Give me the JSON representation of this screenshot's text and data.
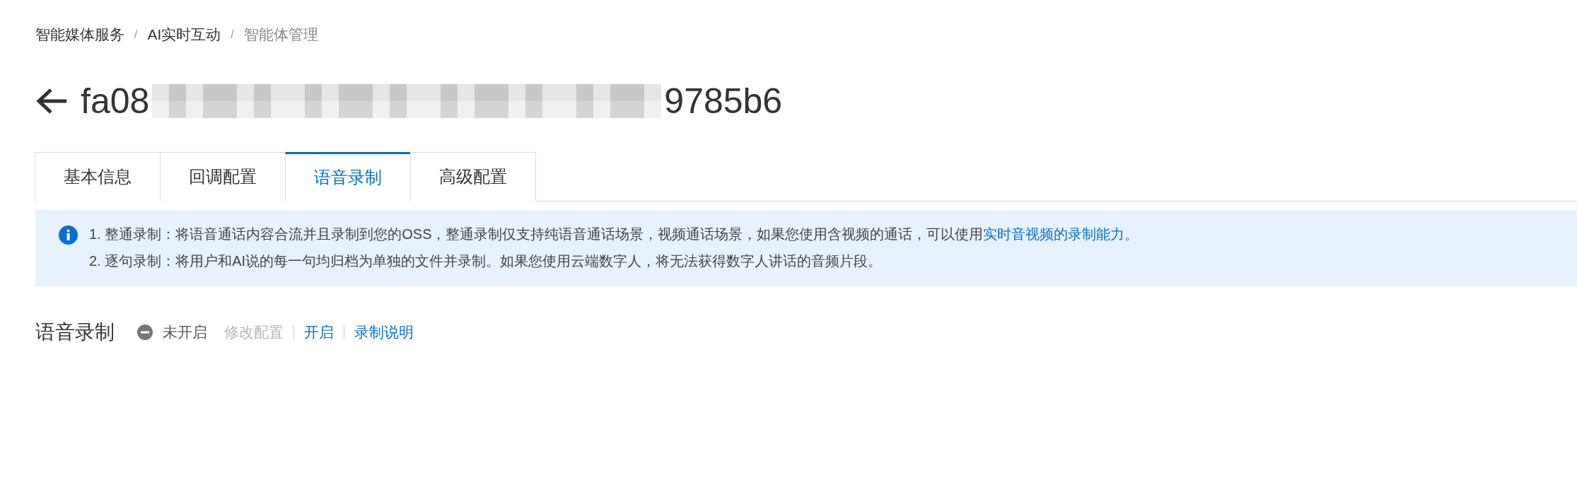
{
  "breadcrumb": [
    {
      "label": "智能媒体服务",
      "current": false
    },
    {
      "label": "AI实时互动",
      "current": false
    },
    {
      "label": "智能体管理",
      "current": true
    }
  ],
  "breadcrumb_separator": "/",
  "title": {
    "prefix": "fa08",
    "suffix": "9785b6"
  },
  "tabs": [
    {
      "label": "基本信息",
      "selected": false
    },
    {
      "label": "回调配置",
      "selected": false
    },
    {
      "label": "语音录制",
      "selected": true
    },
    {
      "label": "高级配置",
      "selected": false
    }
  ],
  "notice": {
    "lines": [
      {
        "text": "1. 整通录制：将语音通话内容合流并且录制到您的OSS，整通录制仅支持纯语音通话场景，视频通话场景，如果您使用含视频的通话，可以使用",
        "link": "实时音视频的录制能力",
        "after": "。"
      },
      {
        "text": "2. 逐句录制：将用户和AI说的每一句均归档为单独的文件并录制。如果您使用云端数字人，将无法获得数字人讲话的音频片段。"
      }
    ]
  },
  "section": {
    "title": "语音录制",
    "status": {
      "label": "未开启",
      "enabled": false
    },
    "actions": [
      {
        "label": "修改配置",
        "disabled": true
      },
      {
        "label": "开启",
        "disabled": false
      },
      {
        "label": "录制说明",
        "disabled": false
      }
    ]
  }
}
